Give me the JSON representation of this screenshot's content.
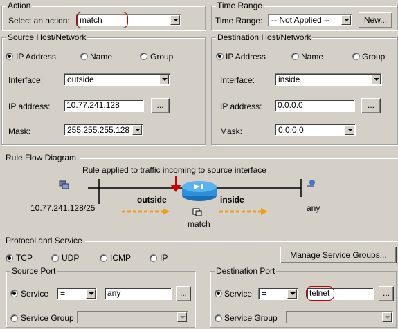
{
  "action": {
    "legend": "Action",
    "select_label": "Select an action:",
    "select_value": "match"
  },
  "time_range": {
    "legend": "Time Range",
    "label": "Time Range:",
    "value": "-- Not Applied --",
    "new_button": "New..."
  },
  "source": {
    "legend": "Source Host/Network",
    "radio_ip": "IP Address",
    "radio_name": "Name",
    "radio_group": "Group",
    "interface_label": "Interface:",
    "interface_value": "outside",
    "ip_label": "IP address:",
    "ip_value": "10.77.241.128",
    "browse": "...",
    "mask_label": "Mask:",
    "mask_value": "255.255.255.128"
  },
  "destination": {
    "legend": "Destination Host/Network",
    "radio_ip": "IP Address",
    "radio_name": "Name",
    "radio_group": "Group",
    "interface_label": "Interface:",
    "interface_value": "inside",
    "ip_label": "IP address:",
    "ip_value": "0.0.0.0",
    "browse": "...",
    "mask_label": "Mask:",
    "mask_value": "0.0.0.0"
  },
  "diagram": {
    "legend": "Rule Flow Diagram",
    "caption": "Rule applied to traffic incoming to source interface",
    "left_interface": "outside",
    "right_interface": "inside",
    "source_net": "10.77.241.128/25",
    "dest_net": "any",
    "action": "match"
  },
  "protocol": {
    "legend": "Protocol and Service",
    "tcp": "TCP",
    "udp": "UDP",
    "icmp": "ICMP",
    "ip": "IP",
    "manage_button": "Manage Service Groups..."
  },
  "source_port": {
    "legend": "Source Port",
    "service_label": "Service",
    "operator": "=",
    "service_value": "any",
    "browse": "...",
    "group_label": "Service Group"
  },
  "dest_port": {
    "legend": "Destination Port",
    "service_label": "Service",
    "operator": "=",
    "service_value": "telnet",
    "browse": "...",
    "group_label": "Service Group"
  },
  "colors": {
    "highlight": "#c00000",
    "arrow": "#e8a020",
    "router": "#2f8fd8"
  }
}
